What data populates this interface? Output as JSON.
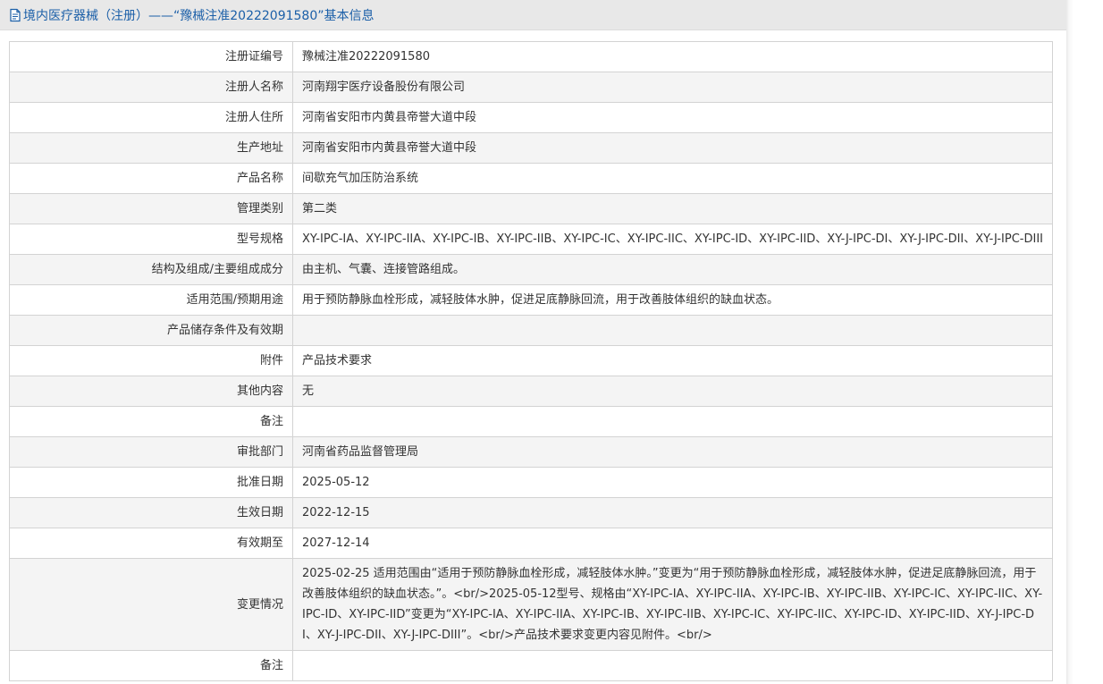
{
  "header": {
    "title": "境内医疗器械（注册）——“豫械注准20222091580”基本信息"
  },
  "rows": [
    {
      "label": "注册证编号",
      "value": "豫械注准20222091580"
    },
    {
      "label": "注册人名称",
      "value": "河南翔宇医疗设备股份有限公司"
    },
    {
      "label": "注册人住所",
      "value": "河南省安阳市内黄县帝誉大道中段"
    },
    {
      "label": "生产地址",
      "value": "河南省安阳市内黄县帝誉大道中段"
    },
    {
      "label": "产品名称",
      "value": "间歇充气加压防治系统"
    },
    {
      "label": "管理类别",
      "value": "第二类"
    },
    {
      "label": "型号规格",
      "value": "XY-IPC-IA、XY-IPC-IIA、XY-IPC-IB、XY-IPC-IIB、XY-IPC-IC、XY-IPC-IIC、XY-IPC-ID、XY-IPC-IID、XY-J-IPC-DI、XY-J-IPC-DII、XY-J-IPC-DIII"
    },
    {
      "label": "结构及组成/主要组成成分",
      "value": "由主机、气囊、连接管路组成。"
    },
    {
      "label": "适用范围/预期用途",
      "value": "用于预防静脉血栓形成，减轻肢体水肿，促进足底静脉回流，用于改善肢体组织的缺血状态。"
    },
    {
      "label": "产品储存条件及有效期",
      "value": ""
    },
    {
      "label": "附件",
      "value": "产品技术要求"
    },
    {
      "label": "其他内容",
      "value": "无"
    },
    {
      "label": "备注",
      "value": ""
    },
    {
      "label": "审批部门",
      "value": "河南省药品监督管理局"
    },
    {
      "label": "批准日期",
      "value": "2025-05-12"
    },
    {
      "label": "生效日期",
      "value": "2022-12-15"
    },
    {
      "label": "有效期至",
      "value": "2027-12-14"
    },
    {
      "label": "变更情况",
      "value": "2025-02-25 适用范围由“适用于预防静脉血栓形成，减轻肢体水肿。”变更为“用于预防静脉血栓形成，减轻肢体水肿，促进足底静脉回流，用于改善肢体组织的缺血状态。”。<br/>2025-05-12型号、规格由“XY-IPC-IA、XY-IPC-IIA、XY-IPC-IB、XY-IPC-IIB、XY-IPC-IC、XY-IPC-IIC、XY-IPC-ID、XY-IPC-IID”变更为“XY-IPC-IA、XY-IPC-IIA、XY-IPC-IB、XY-IPC-IIB、XY-IPC-IC、XY-IPC-IIC、XY-IPC-ID、XY-IPC-IID、XY-J-IPC-DI、XY-J-IPC-DII、XY-J-IPC-DIII”。<br/>产品技术要求变更内容见附件。<br/>"
    },
    {
      "label": "备注",
      "value": ""
    }
  ],
  "colors": {
    "title_text": "#1b5fa8",
    "title_bar_bg": "#e8e8e8",
    "row_alt_bg": "#f4f4f4",
    "border": "#d3d3d3"
  },
  "icons": {
    "title_icon": "document-icon"
  }
}
